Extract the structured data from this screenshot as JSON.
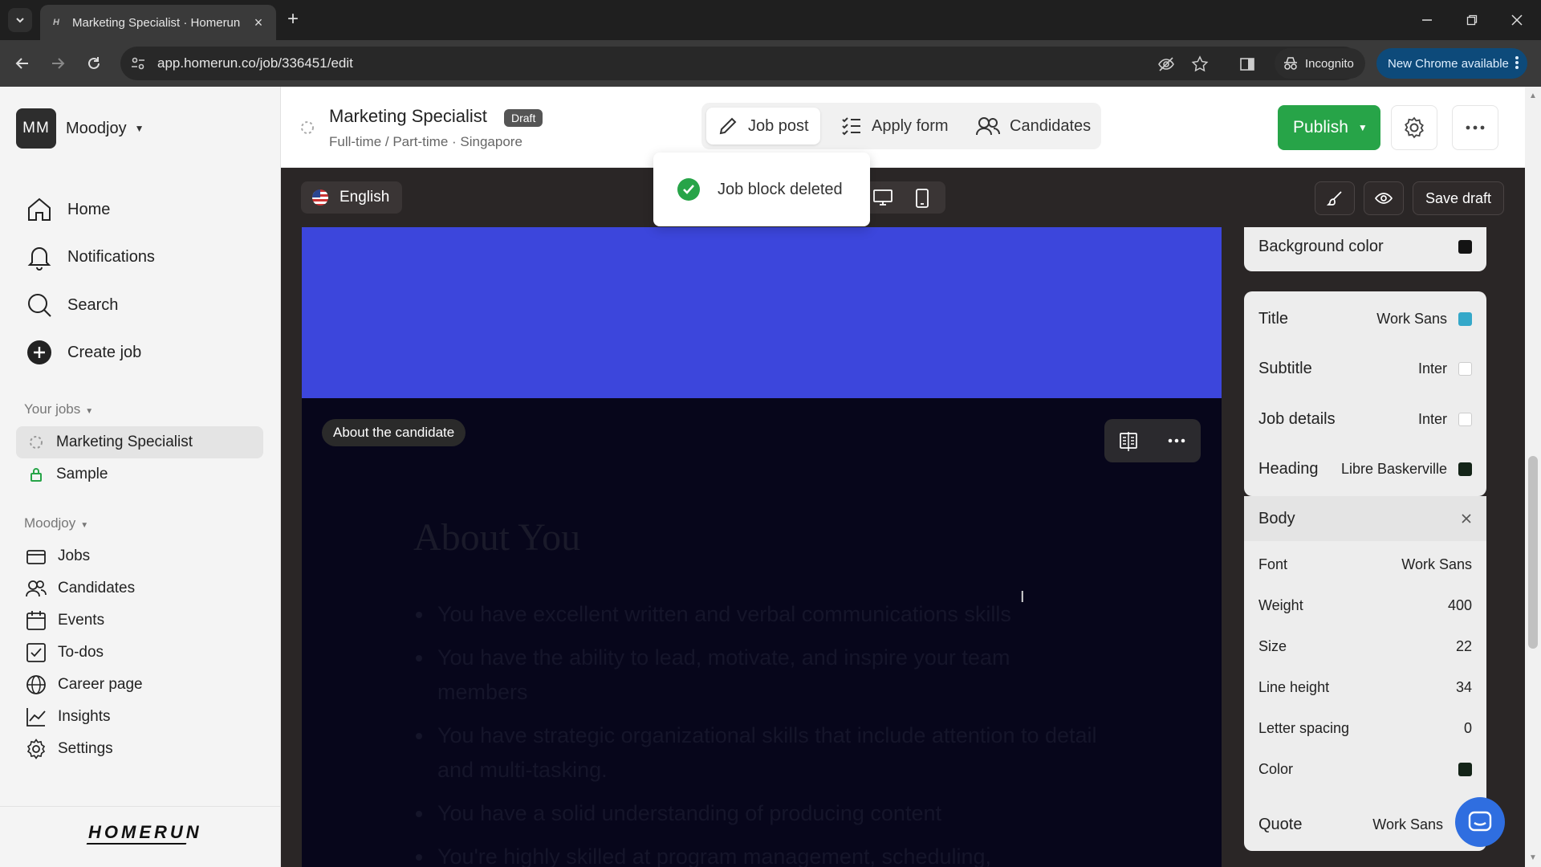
{
  "browser": {
    "tab_title": "Marketing Specialist · Homerun",
    "favicon": "H",
    "url": "app.homerun.co/job/336451/edit",
    "incognito_label": "Incognito",
    "new_chrome_label": "New Chrome available"
  },
  "sidebar": {
    "workspace_initials": "MM",
    "workspace_name": "Moodjoy",
    "nav": [
      {
        "label": "Home",
        "icon": "home-icon"
      },
      {
        "label": "Notifications",
        "icon": "bell-icon"
      },
      {
        "label": "Search",
        "icon": "search-icon"
      },
      {
        "label": "Create job",
        "icon": "plus-circle-icon"
      }
    ],
    "your_jobs_label": "Your jobs",
    "jobs": [
      {
        "label": "Marketing Specialist",
        "active": true
      },
      {
        "label": "Sample",
        "active": false
      }
    ],
    "org_label": "Moodjoy",
    "org_items": [
      {
        "label": "Jobs",
        "icon": "briefcase-icon"
      },
      {
        "label": "Candidates",
        "icon": "people-icon"
      },
      {
        "label": "Events",
        "icon": "calendar-icon"
      },
      {
        "label": "To-dos",
        "icon": "checkbox-icon"
      },
      {
        "label": "Career page",
        "icon": "globe-icon"
      },
      {
        "label": "Insights",
        "icon": "chart-icon"
      },
      {
        "label": "Settings",
        "icon": "gear-icon"
      }
    ],
    "logo": "HOMERUN"
  },
  "header": {
    "job_title": "Marketing Specialist",
    "status_badge": "Draft",
    "job_meta": "Full-time / Part-time · Singapore",
    "tabs": [
      {
        "label": "Job post",
        "active": true
      },
      {
        "label": "Apply form",
        "active": false
      },
      {
        "label": "Candidates",
        "active": false
      }
    ],
    "publish_label": "Publish"
  },
  "editor_bar": {
    "language": "English",
    "save_draft_label": "Save draft"
  },
  "toast": {
    "message": "Job block deleted"
  },
  "canvas": {
    "block_badge": "About the candidate",
    "heading": "About You",
    "bullets": [
      "You have excellent written and verbal communications skills",
      "You have the ability to lead, motivate, and inspire your team members",
      "You have strategic organizational skills that include attention to detail and multi-tasking.",
      "You have a solid understanding of producing content",
      "You're highly skilled at program management, scheduling,"
    ]
  },
  "style_panel": {
    "background_color_label": "Background color",
    "background_color": "#141414",
    "text_styles": [
      {
        "label": "Title",
        "font": "Work Sans",
        "color": "#35a8c9"
      },
      {
        "label": "Subtitle",
        "font": "Inter",
        "color": "#ffffff"
      },
      {
        "label": "Job details",
        "font": "Inter",
        "color": "#ffffff"
      },
      {
        "label": "Heading",
        "font": "Libre Baskerville",
        "color": "#142418"
      }
    ],
    "body": {
      "label": "Body",
      "font_label": "Font",
      "font": "Work Sans",
      "weight_label": "Weight",
      "weight": "400",
      "size_label": "Size",
      "size": "22",
      "line_height_label": "Line height",
      "line_height": "34",
      "letter_spacing_label": "Letter spacing",
      "letter_spacing": "0",
      "color_label": "Color",
      "color": "#142418"
    },
    "quote": {
      "label": "Quote",
      "font": "Work Sans"
    }
  }
}
